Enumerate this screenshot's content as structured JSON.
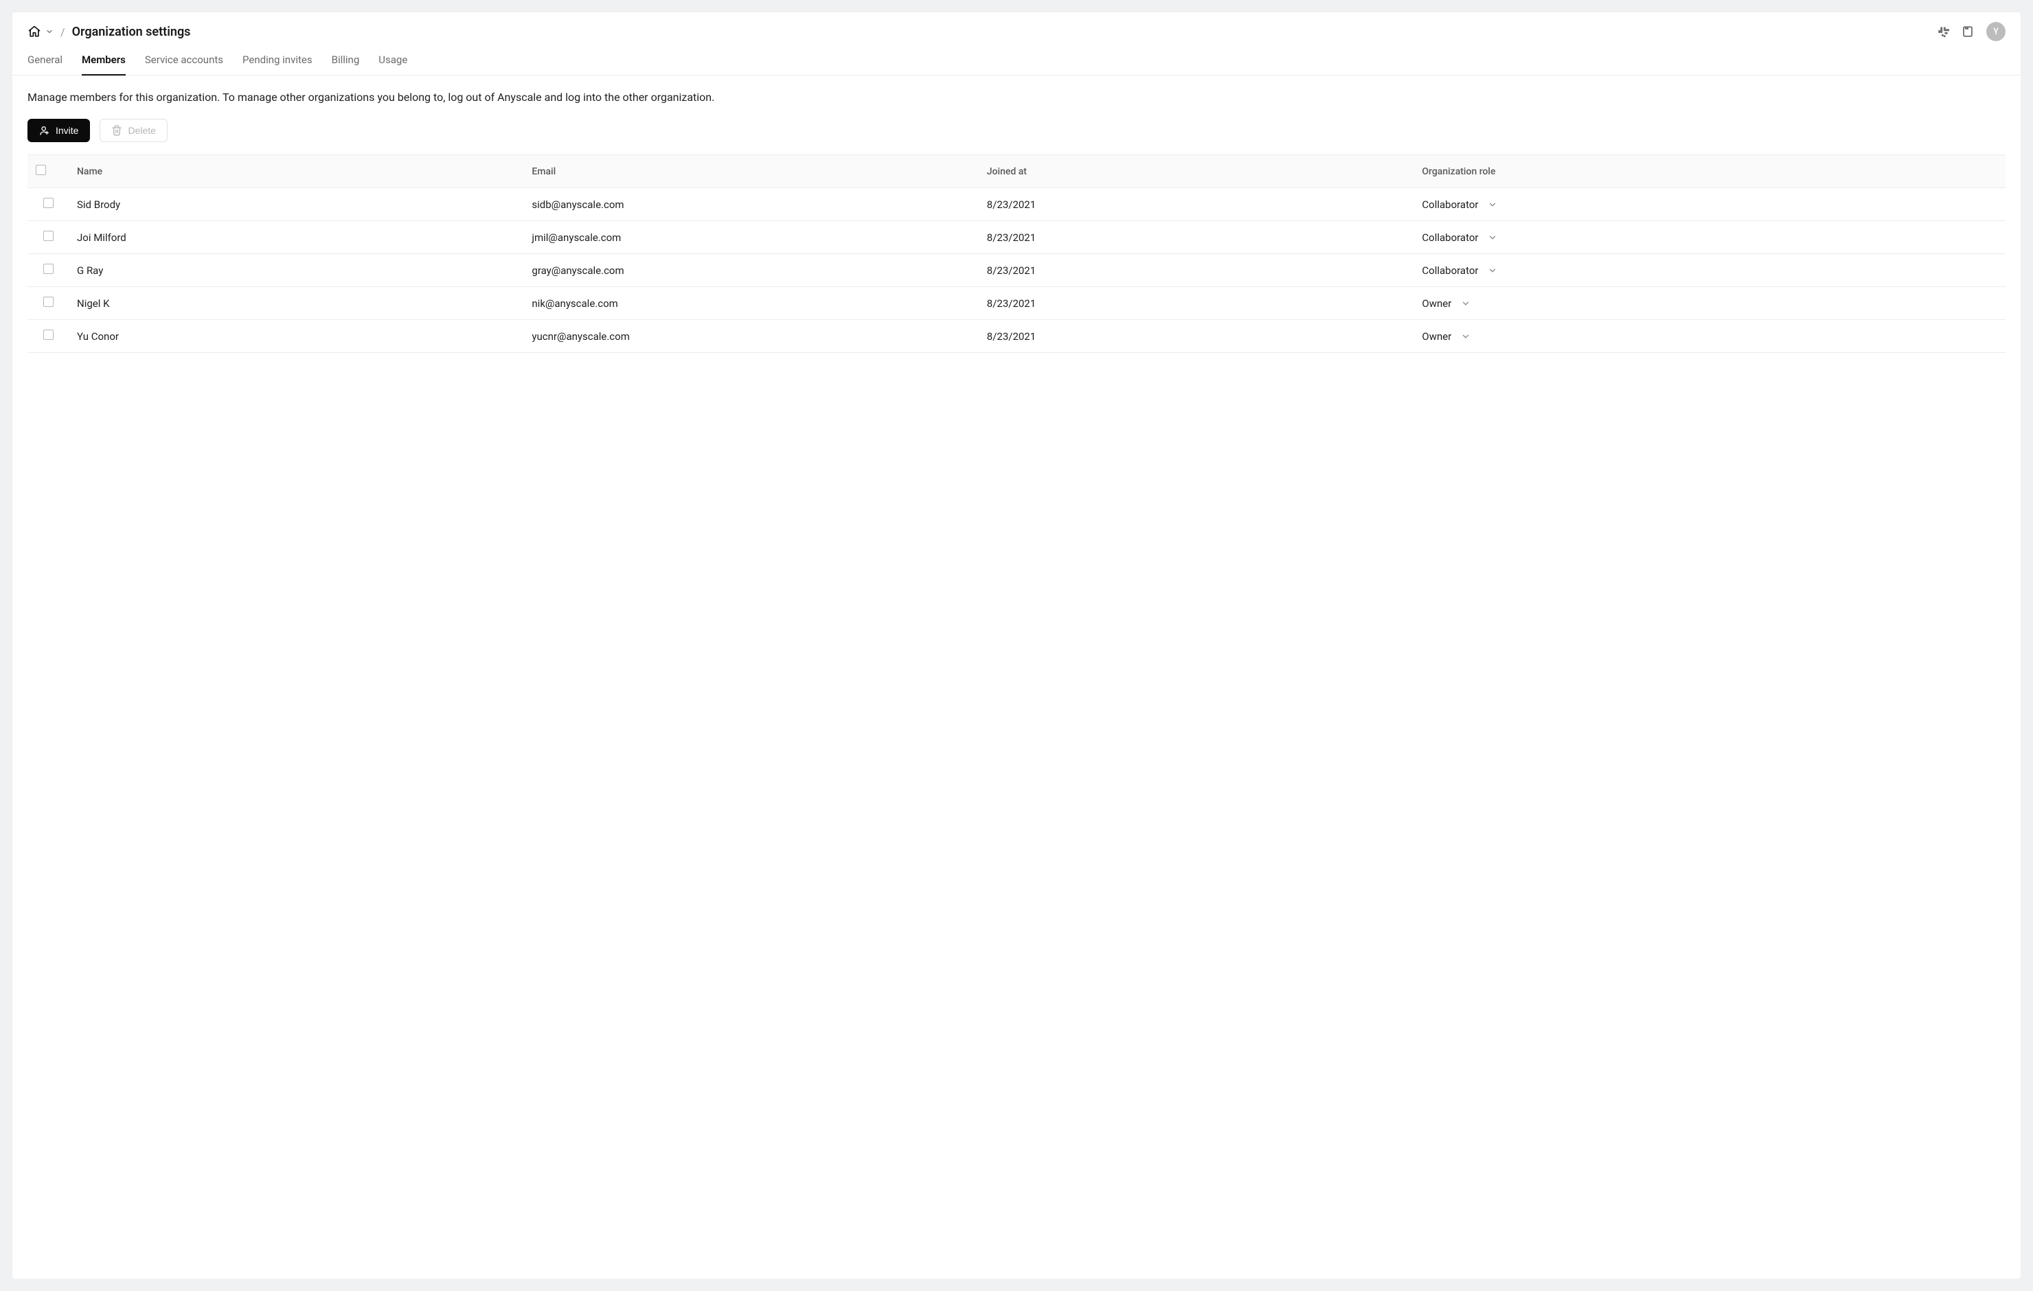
{
  "header": {
    "page_title": "Organization settings",
    "avatar_initial": "Y"
  },
  "tabs": [
    {
      "label": "General",
      "active": false
    },
    {
      "label": "Members",
      "active": true
    },
    {
      "label": "Service accounts",
      "active": false
    },
    {
      "label": "Pending invites",
      "active": false
    },
    {
      "label": "Billing",
      "active": false
    },
    {
      "label": "Usage",
      "active": false
    }
  ],
  "description": "Manage members for this organization. To manage other organizations you belong to, log out of Anyscale and log into the other organization.",
  "actions": {
    "invite_label": "Invite",
    "delete_label": "Delete"
  },
  "table": {
    "columns": {
      "name": "Name",
      "email": "Email",
      "joined": "Joined at",
      "role": "Organization role"
    },
    "rows": [
      {
        "name": "Sid Brody",
        "email": "sidb@anyscale.com",
        "joined": "8/23/2021",
        "role": "Collaborator"
      },
      {
        "name": "Joi Milford",
        "email": "jmil@anyscale.com",
        "joined": "8/23/2021",
        "role": "Collaborator"
      },
      {
        "name": "G Ray",
        "email": "gray@anyscale.com",
        "joined": "8/23/2021",
        "role": "Collaborator"
      },
      {
        "name": "Nigel K",
        "email": "nik@anyscale.com",
        "joined": "8/23/2021",
        "role": "Owner"
      },
      {
        "name": "Yu Conor",
        "email": "yucnr@anyscale.com",
        "joined": "8/23/2021",
        "role": "Owner"
      }
    ]
  }
}
